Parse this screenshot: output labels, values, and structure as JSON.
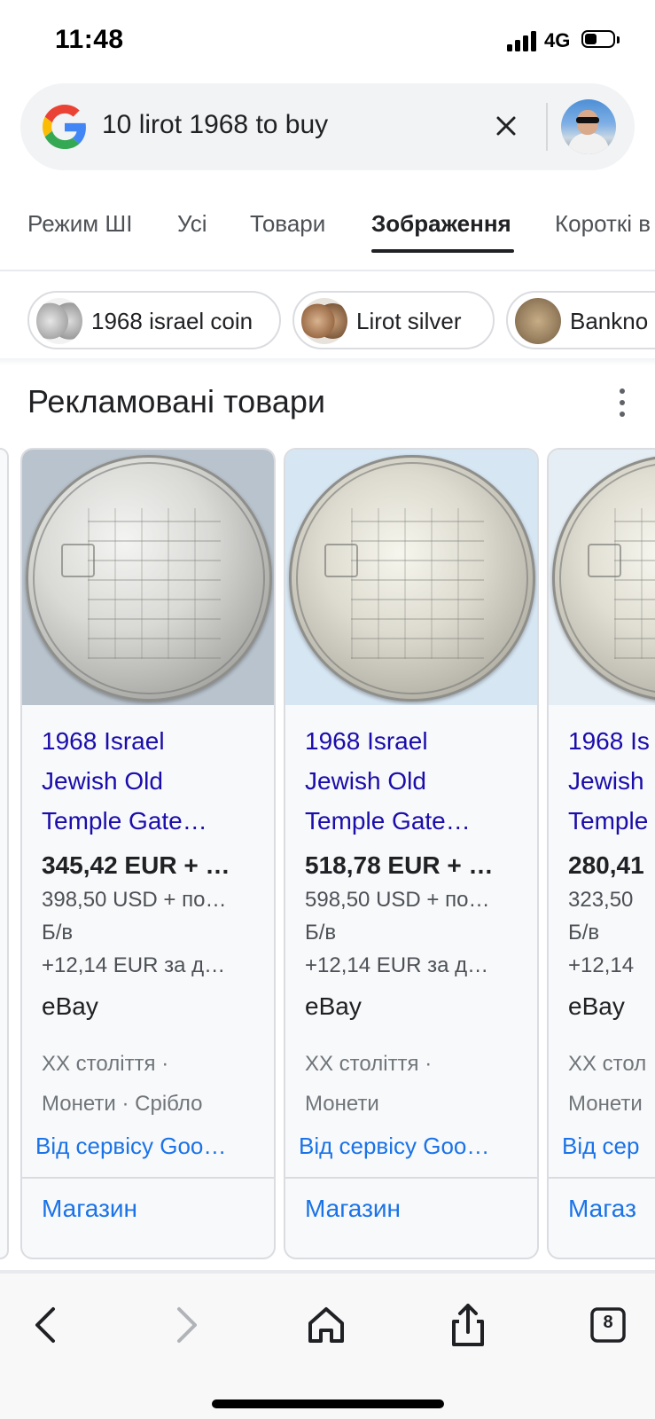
{
  "status_bar": {
    "time": "11:48",
    "network": "4G",
    "battery_level": 0.35
  },
  "search": {
    "query": "10 lirot 1968 to buy"
  },
  "tabs": [
    {
      "label": "Режим ШІ",
      "active": false
    },
    {
      "label": "Усі",
      "active": false
    },
    {
      "label": "Товари",
      "active": false
    },
    {
      "label": "Зображення",
      "active": true
    },
    {
      "label": "Короткі в",
      "active": false
    }
  ],
  "chips": [
    {
      "label": "1968 israel coin"
    },
    {
      "label": "Lirot silver"
    },
    {
      "label": "Bankno"
    }
  ],
  "section": {
    "title": "Рекламовані товари"
  },
  "products": [
    {
      "title_lines": [
        "1968 Israel",
        "Jewish Old",
        "Temple Gate…"
      ],
      "price": "345,42 EUR + …",
      "alt_price": "398,50 USD + по…",
      "condition": "Б/в",
      "shipping": "+12,14 EUR за д…",
      "seller": "eBay",
      "category_lines": [
        "XX століття ·",
        "Монети · Срібло"
      ],
      "source": "Від сервісу Goo…",
      "store_link": "Магазин",
      "bg": "#b9c3cd"
    },
    {
      "title_lines": [
        "1968 Israel",
        "Jewish Old",
        "Temple Gate…"
      ],
      "price": "518,78 EUR + …",
      "alt_price": "598,50 USD + по…",
      "condition": "Б/в",
      "shipping": "+12,14 EUR за д…",
      "seller": "eBay",
      "category_lines": [
        "XX століття ·",
        "Монети"
      ],
      "source": "Від сервісу Goo…",
      "store_link": "Магазин",
      "bg": "#d7e6f3"
    },
    {
      "title_lines": [
        "1968 Is",
        "Jewish",
        "Temple"
      ],
      "price": "280,41",
      "alt_price": "323,50",
      "condition": "Б/в",
      "shipping": "+12,14",
      "seller": "eBay",
      "category_lines": [
        "XX стол",
        "Монети"
      ],
      "source": "Від сер",
      "store_link": "Магаз",
      "bg": "#e6eef5"
    }
  ],
  "toolbar": {
    "tab_count": "8"
  },
  "colors": {
    "link": "#1a0dab",
    "accent": "#1a73e8",
    "text": "#202124"
  }
}
